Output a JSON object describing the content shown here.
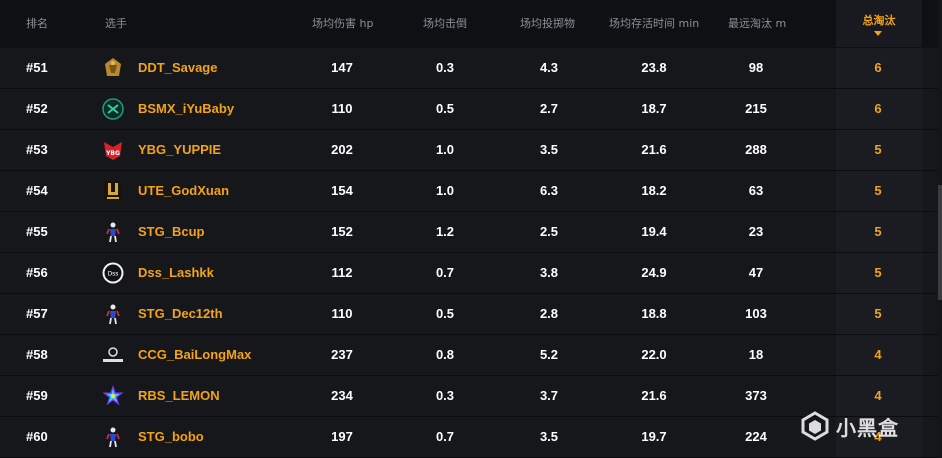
{
  "columns": {
    "rank": "排名",
    "player": "选手",
    "avg_damage": "场均伤害 hp",
    "avg_kills": "场均击倒",
    "avg_throwables": "场均投掷物",
    "avg_survival": "场均存活时间 min",
    "longest_kill": "最远淘汰 m",
    "total_kills": "总淘汰"
  },
  "sorted_column": "total_kills",
  "accent_color": "#f3a317",
  "rows": [
    {
      "rank": "#51",
      "player": "DDT_Savage",
      "team_logo": "ddt-logo",
      "dmg": "147",
      "kills": "0.3",
      "throws": "4.3",
      "surv": "23.8",
      "far": "98",
      "total": "6"
    },
    {
      "rank": "#52",
      "player": "BSMX_iYuBaby",
      "team_logo": "bsmx-logo",
      "dmg": "110",
      "kills": "0.5",
      "throws": "2.7",
      "surv": "18.7",
      "far": "215",
      "total": "6"
    },
    {
      "rank": "#53",
      "player": "YBG_YUPPIE",
      "team_logo": "ybg-logo",
      "dmg": "202",
      "kills": "1.0",
      "throws": "3.5",
      "surv": "21.6",
      "far": "288",
      "total": "5"
    },
    {
      "rank": "#54",
      "player": "UTE_GodXuan",
      "team_logo": "ute-logo",
      "dmg": "154",
      "kills": "1.0",
      "throws": "6.3",
      "surv": "18.2",
      "far": "63",
      "total": "5"
    },
    {
      "rank": "#55",
      "player": "STG_Bcup",
      "team_logo": "stg-logo",
      "dmg": "152",
      "kills": "1.2",
      "throws": "2.5",
      "surv": "19.4",
      "far": "23",
      "total": "5"
    },
    {
      "rank": "#56",
      "player": "Dss_Lashkk",
      "team_logo": "dss-logo",
      "dmg": "112",
      "kills": "0.7",
      "throws": "3.8",
      "surv": "24.9",
      "far": "47",
      "total": "5"
    },
    {
      "rank": "#57",
      "player": "STG_Dec12th",
      "team_logo": "stg-logo",
      "dmg": "110",
      "kills": "0.5",
      "throws": "2.8",
      "surv": "18.8",
      "far": "103",
      "total": "5"
    },
    {
      "rank": "#58",
      "player": "CCG_BaiLongMax",
      "team_logo": "ccg-logo",
      "dmg": "237",
      "kills": "0.8",
      "throws": "5.2",
      "surv": "22.0",
      "far": "18",
      "total": "4"
    },
    {
      "rank": "#59",
      "player": "RBS_LEMON",
      "team_logo": "rbs-logo",
      "dmg": "234",
      "kills": "0.3",
      "throws": "3.7",
      "surv": "21.6",
      "far": "373",
      "total": "4"
    },
    {
      "rank": "#60",
      "player": "STG_bobo",
      "team_logo": "stg-logo",
      "dmg": "197",
      "kills": "0.7",
      "throws": "3.5",
      "surv": "19.7",
      "far": "224",
      "total": "4"
    }
  ],
  "watermark": {
    "text": "小黑盒",
    "icon": "xiaoheihe-logo"
  }
}
